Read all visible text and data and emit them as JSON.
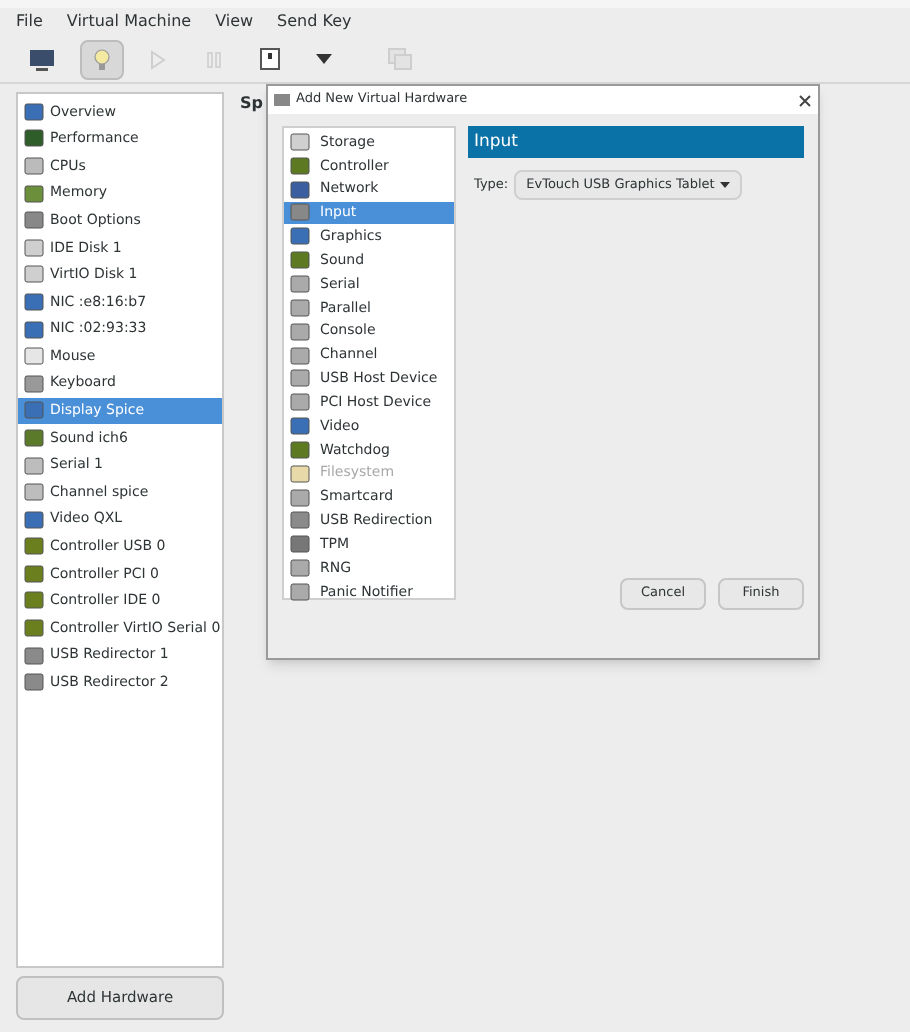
{
  "menu": [
    "File",
    "Virtual Machine",
    "View",
    "Send Key"
  ],
  "toolbar": [
    {
      "kind": "console",
      "selected": false,
      "disabled": false
    },
    {
      "kind": "details",
      "selected": true,
      "disabled": false
    },
    {
      "kind": "run",
      "selected": false,
      "disabled": true
    },
    {
      "kind": "pause",
      "selected": false,
      "disabled": true
    },
    {
      "kind": "power",
      "selected": false,
      "disabled": false
    },
    {
      "kind": "caret",
      "selected": false,
      "disabled": false
    },
    {
      "kind": "snapshot",
      "selected": false,
      "disabled": true
    }
  ],
  "sidebar": {
    "items": [
      {
        "label": "Overview",
        "selected": false
      },
      {
        "label": "Performance",
        "selected": false
      },
      {
        "label": "CPUs",
        "selected": false
      },
      {
        "label": "Memory",
        "selected": false
      },
      {
        "label": "Boot Options",
        "selected": false
      },
      {
        "label": "IDE Disk 1",
        "selected": false
      },
      {
        "label": "VirtIO Disk 1",
        "selected": false
      },
      {
        "label": "NIC :e8:16:b7",
        "selected": false
      },
      {
        "label": "NIC :02:93:33",
        "selected": false
      },
      {
        "label": "Mouse",
        "selected": false
      },
      {
        "label": "Keyboard",
        "selected": false
      },
      {
        "label": "Display Spice",
        "selected": true
      },
      {
        "label": "Sound ich6",
        "selected": false
      },
      {
        "label": "Serial 1",
        "selected": false
      },
      {
        "label": "Channel spice",
        "selected": false
      },
      {
        "label": "Video QXL",
        "selected": false
      },
      {
        "label": "Controller USB 0",
        "selected": false
      },
      {
        "label": "Controller PCI 0",
        "selected": false
      },
      {
        "label": "Controller IDE 0",
        "selected": false
      },
      {
        "label": "Controller VirtIO Serial 0",
        "selected": false
      },
      {
        "label": "USB Redirector 1",
        "selected": false
      },
      {
        "label": "USB Redirector 2",
        "selected": false
      }
    ],
    "add_button": "Add Hardware"
  },
  "main": {
    "heading": "Sp"
  },
  "dialog": {
    "title": "Add New Virtual Hardware",
    "items": [
      {
        "label": "Storage",
        "selected": false,
        "disabled": false
      },
      {
        "label": "Controller",
        "selected": false,
        "disabled": false
      },
      {
        "label": "Network",
        "selected": false,
        "disabled": false
      },
      {
        "label": "Input",
        "selected": true,
        "disabled": false
      },
      {
        "label": "Graphics",
        "selected": false,
        "disabled": false
      },
      {
        "label": "Sound",
        "selected": false,
        "disabled": false
      },
      {
        "label": "Serial",
        "selected": false,
        "disabled": false
      },
      {
        "label": "Parallel",
        "selected": false,
        "disabled": false
      },
      {
        "label": "Console",
        "selected": false,
        "disabled": false
      },
      {
        "label": "Channel",
        "selected": false,
        "disabled": false
      },
      {
        "label": "USB Host Device",
        "selected": false,
        "disabled": false
      },
      {
        "label": "PCI Host Device",
        "selected": false,
        "disabled": false
      },
      {
        "label": "Video",
        "selected": false,
        "disabled": false
      },
      {
        "label": "Watchdog",
        "selected": false,
        "disabled": false
      },
      {
        "label": "Filesystem",
        "selected": false,
        "disabled": true
      },
      {
        "label": "Smartcard",
        "selected": false,
        "disabled": false
      },
      {
        "label": "USB Redirection",
        "selected": false,
        "disabled": false
      },
      {
        "label": "TPM",
        "selected": false,
        "disabled": false
      },
      {
        "label": "RNG",
        "selected": false,
        "disabled": false
      },
      {
        "label": "Panic Notifier",
        "selected": false,
        "disabled": false
      }
    ],
    "panel_title": "Input",
    "type_label": "Type:",
    "type_value": "EvTouch USB Graphics Tablet",
    "buttons": [
      "Cancel",
      "Finish"
    ]
  }
}
